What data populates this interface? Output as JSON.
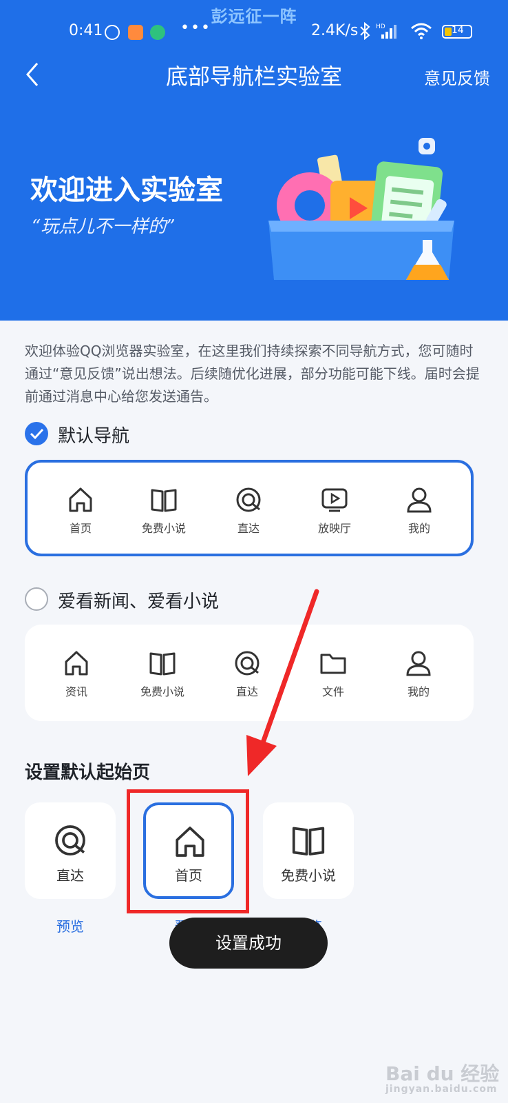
{
  "watermark_top": "彭远征一阵",
  "status_bar": {
    "time": "0:41",
    "dots": "•••",
    "network_speed": "2.4K/s",
    "battery": "14"
  },
  "nav": {
    "title": "底部导航栏实验室",
    "feedback": "意见反馈"
  },
  "hero": {
    "title": "欢迎进入实验室",
    "subtitle": "“玩点儿不一样的”"
  },
  "intro": "欢迎体验QQ浏览器实验室，在这里我们持续探索不同导航方式，您可随时通过“意见反馈”说出想法。后续随优化进展，部分功能可能下线。届时会提前通过消息中心给您发送通告。",
  "options": [
    {
      "label": "默认导航",
      "selected": true,
      "items": [
        {
          "label": "首页",
          "icon": "home-icon"
        },
        {
          "label": "免费小说",
          "icon": "book-icon"
        },
        {
          "label": "直达",
          "icon": "direct-icon"
        },
        {
          "label": "放映厅",
          "icon": "tv-play-icon"
        },
        {
          "label": "我的",
          "icon": "user-icon"
        }
      ]
    },
    {
      "label": "爱看新闻、爱看小说",
      "selected": false,
      "items": [
        {
          "label": "资讯",
          "icon": "home-icon"
        },
        {
          "label": "免费小说",
          "icon": "book-icon"
        },
        {
          "label": "直达",
          "icon": "direct-icon"
        },
        {
          "label": "文件",
          "icon": "folder-icon"
        },
        {
          "label": "我的",
          "icon": "user-icon"
        }
      ]
    }
  ],
  "start_page": {
    "title": "设置默认起始页",
    "cards": [
      {
        "label": "直达",
        "icon": "direct-icon",
        "selected": false
      },
      {
        "label": "首页",
        "icon": "home-icon",
        "selected": true
      },
      {
        "label": "免费小说",
        "icon": "book-icon",
        "selected": false
      }
    ],
    "preview": "预览"
  },
  "toast": "设置成功",
  "watermark_bottom": {
    "brand": "Bai du 经验",
    "url": "jingyan.baidu.com"
  },
  "colors": {
    "header_blue": "#1f6fe8",
    "accent": "#2a6fe0",
    "annotation_red": "#ef2828",
    "toast_bg": "#1e1e1e"
  }
}
